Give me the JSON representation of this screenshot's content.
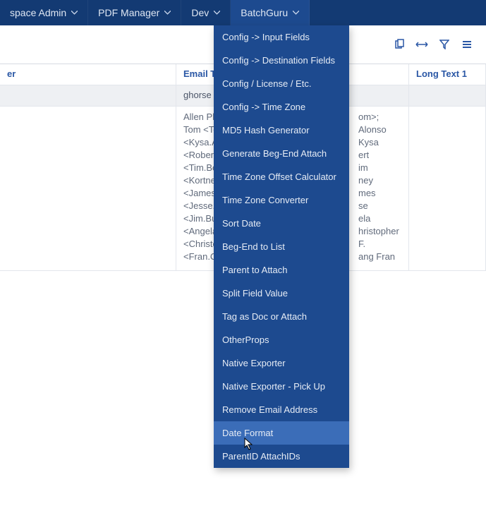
{
  "menubar": {
    "items": [
      {
        "label": "space Admin"
      },
      {
        "label": "PDF Manager"
      },
      {
        "label": "Dev"
      },
      {
        "label": "BatchGuru"
      }
    ],
    "active_index": 3
  },
  "dropdown": {
    "items": [
      "Config -> Input Fields",
      "Config -> Destination Fields",
      "Config / License / Etc.",
      "Config -> Time Zone",
      "MD5 Hash Generator",
      "Generate Beg-End Attach",
      "Time Zone Offset Calculator",
      "Time Zone Converter",
      "Sort Date",
      "Beg-End to List",
      "Parent to Attach",
      "Split Field Value",
      "Tag as Doc or Attach",
      "OtherProps",
      "Native Exporter",
      "Native Exporter - Pick Up",
      "Remove Email Address",
      "Date Format",
      "ParentID AttachIDs"
    ],
    "hover_index": 17
  },
  "table": {
    "headers": {
      "c0": "er",
      "c1": "Email To",
      "c2": "Long Text 1"
    },
    "row1": {
      "c1_value": "ghorse"
    },
    "body_lines": [
      "Allen Phi",
      "Tom <To",
      "<Kysa.Al",
      "<Robert.",
      "<Tim.Bel",
      "<Kortney",
      "<James.B",
      "<Jesse.B",
      "<Jim.Bue",
      "<Angela.",
      "<Christo",
      "<Fran.Ch"
    ],
    "body_right_lines": [
      "om>; Alonso",
      "Kysa",
      "ert",
      "im",
      "ney",
      "mes",
      "se",
      "",
      "ela",
      "hristopher F.",
      "ang Fran",
      ""
    ]
  }
}
